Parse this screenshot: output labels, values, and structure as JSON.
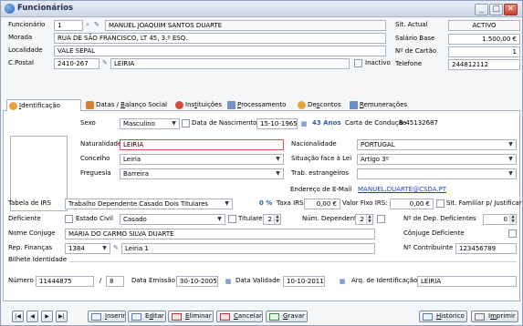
{
  "window": {
    "title": "Funcionários",
    "min": "_",
    "max": "□",
    "close": "✕"
  },
  "header": {
    "funcionario_label": "Funcionário",
    "funcionario_id": "1",
    "nome": "MANUEL JOAQUIM SANTOS DUARTE",
    "sit_actual_label": "Sit. Actual",
    "sit_actual": "ACTIVO",
    "morada_label": "Morada",
    "morada": "RUA DE SÃO FRANCISCO, LT 45, 3.º ESQ.",
    "salario_label": "Salário Base",
    "salario": "1.500,00 €",
    "localidade_label": "Localidade",
    "localidade": "VALE SEPAL",
    "cartao_label": "Nº de Cartão",
    "cartao": "1",
    "cpostal_label": "C.Postal",
    "cpostal": "2410-267",
    "cpostal_loc": "LEIRIA",
    "inactivo_label": "Inactivo",
    "telefone_label": "Telefone",
    "telefone": "244812112"
  },
  "tabs": [
    {
      "label": "Identificação",
      "u": "I",
      "rest": "dentificação"
    },
    {
      "label": "Datas / Balanço Social",
      "u": "B",
      "pre": "Datas / ",
      "rest": "alanço Social"
    },
    {
      "label": "Instituições",
      "pre": "Ins",
      "u": "t",
      "rest": "ituições"
    },
    {
      "label": "Processamento",
      "u": "P",
      "rest": "rocessamento"
    },
    {
      "label": "Descontos",
      "pre": "De",
      "u": "s",
      "rest": "contos"
    },
    {
      "label": "Remunerações",
      "u": "R",
      "rest": "emunerações"
    }
  ],
  "ident": {
    "sexo_label": "Sexo",
    "sexo": "Masculino",
    "nasc_label": "Data de Nascimento",
    "nasc": "15-10-1965",
    "idade": "43 Anos",
    "carta_label": "Carta de Condução",
    "carta": "B-45132687",
    "naturalidade_label": "Naturalidade",
    "naturalidade": "LEIRIA",
    "nacionalidade_label": "Nacionalidade",
    "nacionalidade": "PORTUGAL",
    "concelho_label": "Concelho",
    "concelho": "Leiria",
    "situacao_label": "Situação face à Lei",
    "situacao": "Artigo 3º",
    "freguesia_label": "Freguesia",
    "freguesia": "Barreira",
    "trab_label": "Trab. estrangeiros",
    "trab": "",
    "email_label": "Endereço de E-Mail",
    "email": "MANUEL.DUARTE@CSDA.PT",
    "irs_label": "Tabela de IRS",
    "irs": "Trabalho Dependente Casado Dois Titulares",
    "irs_pct": "0 %",
    "taxa_label": "Taxa IRS:",
    "taxa": "0,00 €",
    "fixo_label": "Valor Fixo IRS:",
    "fixo": "0,00 €",
    "sit_fam_label": "Sit. Familiar p/ Justificar",
    "deficiente_label": "Deficiente",
    "estado_civil_label": "Estado Civil",
    "estado_civil": "Casado",
    "titulares_label": "Titulares",
    "titulares": "2",
    "num_dep_label": "Núm. Dependentes",
    "num_dep": "2",
    "dep_def_label": "Nº de Dep. Deficientes",
    "dep_def": "0",
    "conjuge_label": "Nome Conjuge",
    "conjuge": "MARIA DO CARMO SILVA DUARTE",
    "conj_def_label": "Cônjuge Deficiente",
    "rep_label": "Rep. Finanças",
    "rep_code": "1384",
    "rep_name": "Leiria 1",
    "contribuinte_label": "Nº Contribuinte",
    "contribuinte": "123456789",
    "bilhete_group": "Bilhete Identidade",
    "numero_label": "Número",
    "numero": "11444875",
    "numero_sep": "/",
    "numero_suf": "8",
    "emissao_label": "Data Emissão",
    "emissao": "30-10-2005",
    "validade_label": "Data Validade",
    "validade": "10-10-2011",
    "arquivo_label": "Arq. de Identificação",
    "arquivo": "LEIRIA"
  },
  "nav": {
    "first": "|◀",
    "prev": "◀",
    "next": "▶",
    "last": "▶|"
  },
  "actions": [
    {
      "name": "inserir",
      "pre": "",
      "u": "I",
      "rest": "nserir"
    },
    {
      "name": "editar",
      "pre": "E",
      "u": "d",
      "rest": "itar"
    },
    {
      "name": "eliminar",
      "pre": "",
      "u": "E",
      "rest": "liminar"
    },
    {
      "name": "cancelar",
      "pre": "",
      "u": "C",
      "rest": "ancelar"
    },
    {
      "name": "gravar",
      "pre": "",
      "u": "G",
      "rest": "ravar"
    }
  ],
  "historico_label": "Histórico",
  "historico_u": "H",
  "historico_rest": "istórico",
  "imprimir_label": "Imprimir",
  "imprimir_u": "m",
  "imprimir_pre": "I",
  "imprimir_rest": "primir"
}
